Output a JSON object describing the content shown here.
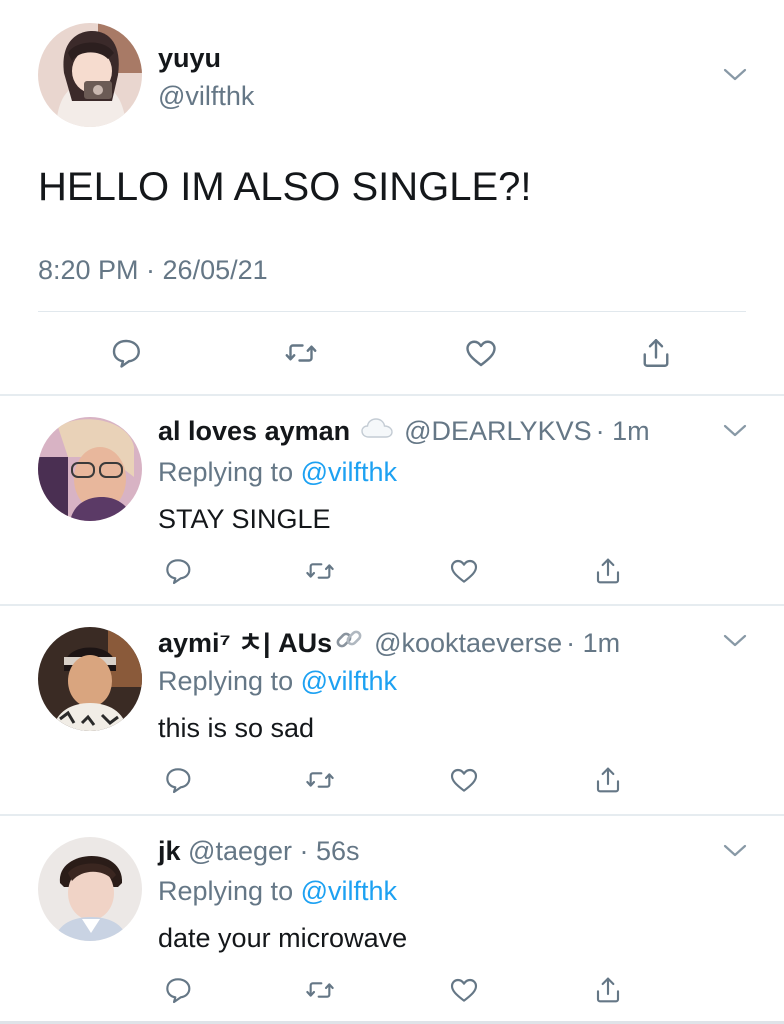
{
  "main_tweet": {
    "display_name": "yuyu",
    "handle": "@vilfthk",
    "text": "HELLO IM ALSO SINGLE?!",
    "timestamp": "8:20 PM · 26/05/21"
  },
  "replies": [
    {
      "display_name": "al loves ayman",
      "badge_icon": "cloud-icon",
      "handle": "@DEARLYKVS",
      "time": "· 1m",
      "replying_prefix": "Replying to",
      "replying_handle": "@vilfthk",
      "text": "STAY SINGLE"
    },
    {
      "display_name": "aymi⁷ ㅊ| AUs",
      "badge_icon": "link-icon",
      "handle": "@kooktaeverse",
      "time": "· 1m",
      "replying_prefix": "Replying to",
      "replying_handle": "@vilfthk",
      "text": "this is so sad"
    },
    {
      "display_name": "jk",
      "handle": "@taeger",
      "time": "· 56s",
      "replying_prefix": "Replying to",
      "replying_handle": "@vilfthk",
      "text": "date your microwave"
    }
  ],
  "actions": [
    "reply-icon",
    "retweet-icon",
    "like-icon",
    "share-icon"
  ],
  "colors": {
    "text": "#14171a",
    "secondary": "#657786",
    "link": "#1da1f2",
    "icon": "#657786",
    "divider": "#e6ecf0"
  }
}
